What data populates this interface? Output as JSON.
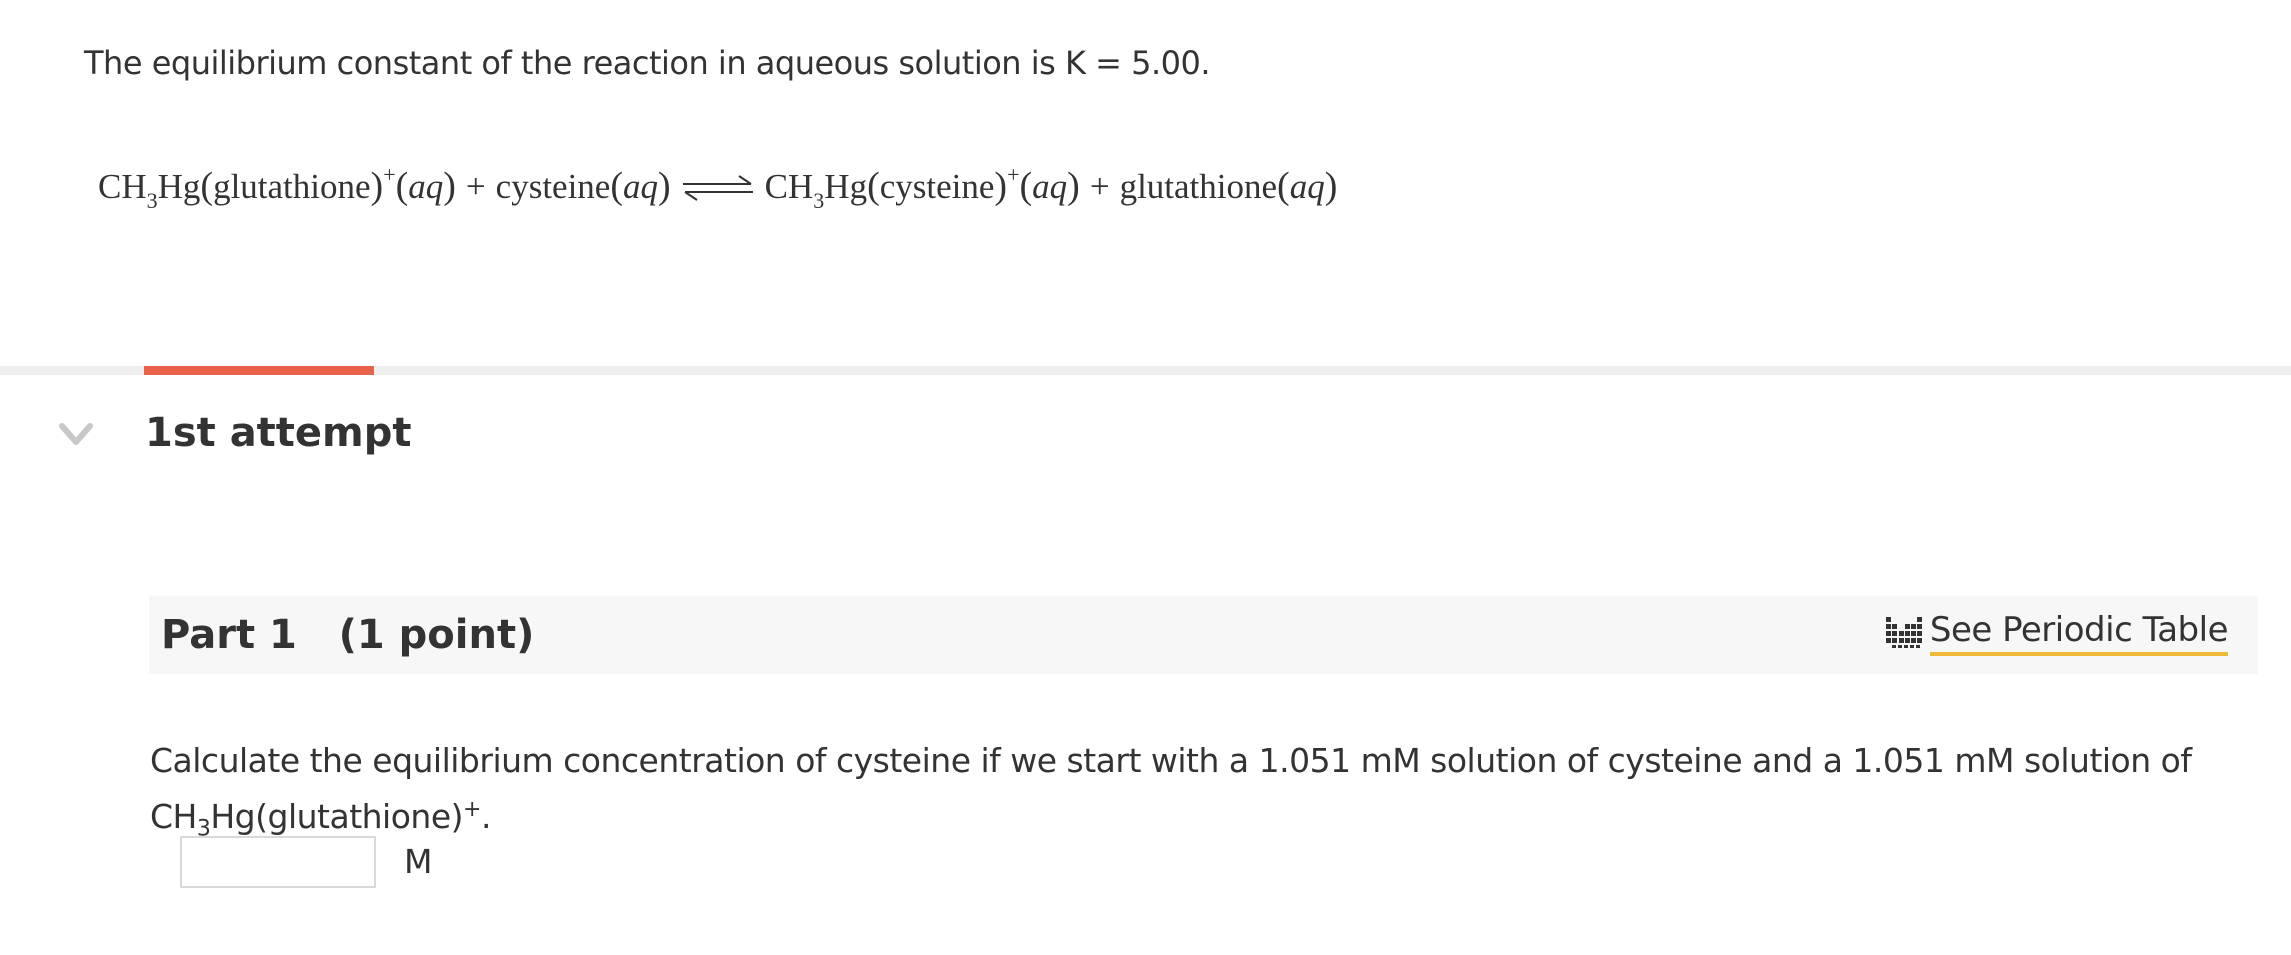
{
  "intro_text": "The equilibrium constant of the reaction in aqueous solution is K = 5.00.",
  "equation": {
    "r1_ch": "CH",
    "r1_sub": "3",
    "r1_hg": "Hg",
    "r1_ligand": "glutathione",
    "r1_charge": "+",
    "phase": "aq",
    "plus": "+",
    "r2": "cysteine",
    "p1_ch": "CH",
    "p1_sub": "3",
    "p1_hg": "Hg",
    "p1_ligand": "cysteine",
    "p1_charge": "+",
    "p2": "glutathione",
    "open": "(",
    "close": ")"
  },
  "attempt_title": "1st attempt",
  "part": {
    "label": "Part 1",
    "points": "(1 point)",
    "periodic_link": "See Periodic Table"
  },
  "question": {
    "text_before": "Calculate the equilibrium concentration of cysteine if we start with a 1.051  mM solution of cysteine and a 1.051  mM solution of CH",
    "sub": "3",
    "text_mid": "Hg(glutathione)",
    "sup": "+",
    "text_end": "."
  },
  "answer": {
    "value": "",
    "placeholder": "",
    "unit": "M"
  },
  "colors": {
    "accent": "#e8614a",
    "link_underline": "#f0b93a",
    "divider": "#eeeeee",
    "part_header_bg": "#f7f7f7"
  },
  "icons": {
    "chevron": "chevron-down-icon",
    "periodic": "periodic-table-icon"
  }
}
